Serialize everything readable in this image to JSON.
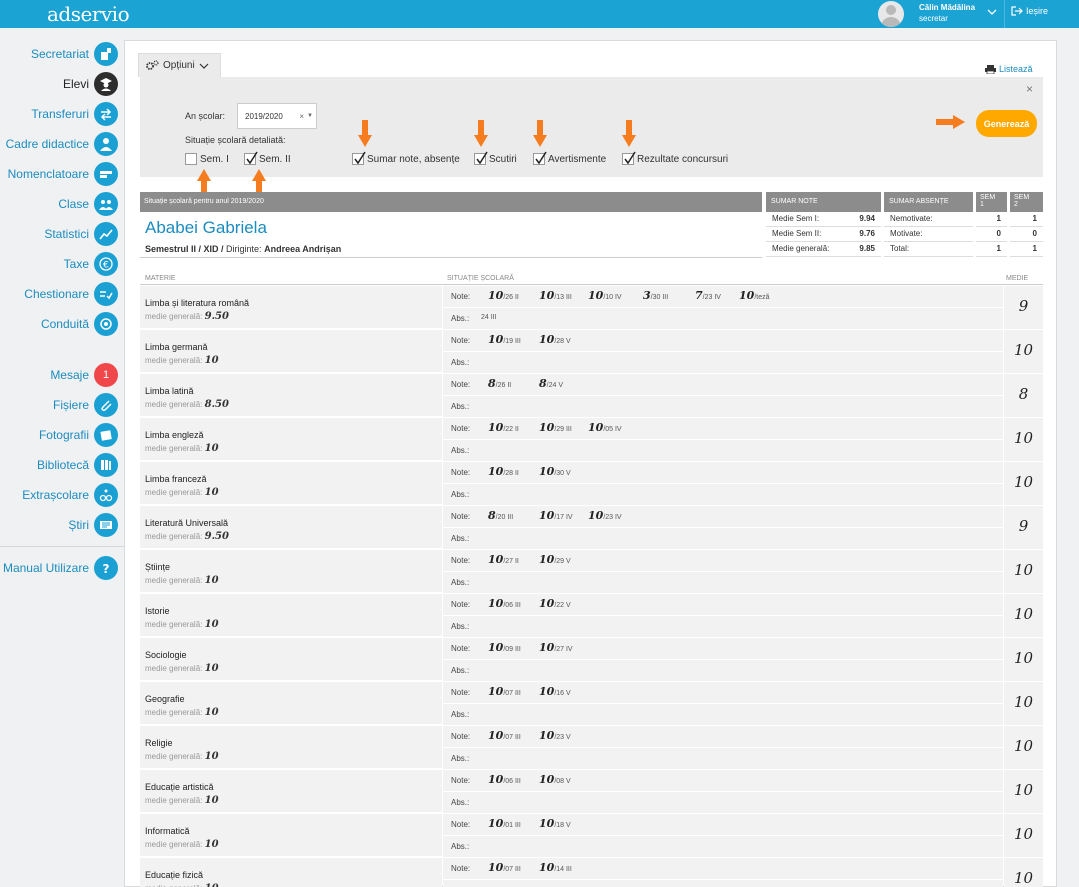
{
  "app": {
    "logo": "adservio"
  },
  "user": {
    "name": "Călin Mădălina",
    "role": "secretar",
    "logout": "Ieșire"
  },
  "sidebar": {
    "items": [
      {
        "label": "Secretariat"
      },
      {
        "label": "Elevi"
      },
      {
        "label": "Transferuri"
      },
      {
        "label": "Cadre didactice"
      },
      {
        "label": "Nomenclatoare"
      },
      {
        "label": "Clase"
      },
      {
        "label": "Statistici"
      },
      {
        "label": "Taxe"
      },
      {
        "label": "Chestionare"
      },
      {
        "label": "Conduită"
      },
      {
        "label": "Mesaje",
        "badge": "1"
      },
      {
        "label": "Fișiere"
      },
      {
        "label": "Fotografii"
      },
      {
        "label": "Bibliotecă"
      },
      {
        "label": "Extrașcolare"
      },
      {
        "label": "Știri"
      },
      {
        "label": "Manual Utilizare"
      }
    ]
  },
  "options": {
    "tab": "Opțiuni",
    "print": "Listează",
    "year_label": "An școlar:",
    "year_value": "2019/2020",
    "situation_label": "Situație școlară detaliată:",
    "checkboxes": [
      {
        "label": "Sem. I",
        "checked": false
      },
      {
        "label": "Sem. II",
        "checked": true
      },
      {
        "label": "Sumar note, absențe",
        "checked": true
      },
      {
        "label": "Scutiri",
        "checked": true
      },
      {
        "label": "Avertismente",
        "checked": true
      },
      {
        "label": "Rezultate concursuri",
        "checked": true
      }
    ],
    "generate": "Generează"
  },
  "report": {
    "header": "Situație școlară pentru anul 2019/2020",
    "student": "Ababei Gabriela",
    "semester": "Semestrul II / XID /",
    "teacher_label": "Diriginte:",
    "teacher": "Andreea Andrișan",
    "sumar_note": {
      "title": "SUMAR NOTE",
      "rows": [
        {
          "k": "Medie Sem I:",
          "v": "9.94"
        },
        {
          "k": "Medie Sem II:",
          "v": "9.76"
        },
        {
          "k": "Medie generală:",
          "v": "9.85"
        }
      ]
    },
    "sumar_absente": {
      "title": "SUMAR ABSENȚE",
      "sem1": "SEM 1",
      "sem2": "SEM 2",
      "rows": [
        {
          "k": "Nemotivate:",
          "s1": "1",
          "s2": "1"
        },
        {
          "k": "Motivate:",
          "s1": "0",
          "s2": "0"
        },
        {
          "k": "Total:",
          "s1": "1",
          "s2": "1"
        }
      ]
    },
    "columns": {
      "subject": "MATERIE",
      "situation": "SITUAȚIE ȘCOLARĂ",
      "average": "MEDIE"
    },
    "notes_label": "Note:",
    "abs_label": "Abs.:",
    "mg_label": "medie generală:",
    "subjects": [
      {
        "name": "Limba și literatura română",
        "mg": "9.50",
        "avg": "9",
        "grades": [
          {
            "g": "10",
            "d": "/26 II"
          },
          {
            "g": "10",
            "d": "/13 III"
          },
          {
            "g": "10",
            "d": "/10 IV"
          },
          {
            "g": "3",
            "d": "/30 III"
          },
          {
            "g": "7",
            "d": "/23 IV"
          },
          {
            "g": "10",
            "d": "/teză"
          }
        ],
        "abs": "24 III"
      },
      {
        "name": "Limba germană",
        "mg": "10",
        "avg": "10",
        "grades": [
          {
            "g": "10",
            "d": "/19 III"
          },
          {
            "g": "10",
            "d": "/28 V"
          }
        ],
        "abs": ""
      },
      {
        "name": "Limba latină",
        "mg": "8.50",
        "avg": "8",
        "grades": [
          {
            "g": "8",
            "d": "/26 II"
          },
          {
            "g": "8",
            "d": "/24 V"
          }
        ],
        "abs": ""
      },
      {
        "name": "Limba engleză",
        "mg": "10",
        "avg": "10",
        "grades": [
          {
            "g": "10",
            "d": "/22 II"
          },
          {
            "g": "10",
            "d": "/29 III"
          },
          {
            "g": "10",
            "d": "/05 IV"
          }
        ],
        "abs": ""
      },
      {
        "name": "Limba franceză",
        "mg": "10",
        "avg": "10",
        "grades": [
          {
            "g": "10",
            "d": "/28 II"
          },
          {
            "g": "10",
            "d": "/30 V"
          }
        ],
        "abs": ""
      },
      {
        "name": "Literatură Universală",
        "mg": "9.50",
        "avg": "9",
        "grades": [
          {
            "g": "8",
            "d": "/20 III"
          },
          {
            "g": "10",
            "d": "/17 IV"
          },
          {
            "g": "10",
            "d": "/23 IV"
          }
        ],
        "abs": ""
      },
      {
        "name": "Științe",
        "mg": "10",
        "avg": "10",
        "grades": [
          {
            "g": "10",
            "d": "/27 II"
          },
          {
            "g": "10",
            "d": "/29 V"
          }
        ],
        "abs": ""
      },
      {
        "name": "Istorie",
        "mg": "10",
        "avg": "10",
        "grades": [
          {
            "g": "10",
            "d": "/06 III"
          },
          {
            "g": "10",
            "d": "/22 V"
          }
        ],
        "abs": ""
      },
      {
        "name": "Sociologie",
        "mg": "10",
        "avg": "10",
        "grades": [
          {
            "g": "10",
            "d": "/09 III"
          },
          {
            "g": "10",
            "d": "/27 IV"
          }
        ],
        "abs": ""
      },
      {
        "name": "Geografie",
        "mg": "10",
        "avg": "10",
        "grades": [
          {
            "g": "10",
            "d": "/07 III"
          },
          {
            "g": "10",
            "d": "/16 V"
          }
        ],
        "abs": ""
      },
      {
        "name": "Religie",
        "mg": "10",
        "avg": "10",
        "grades": [
          {
            "g": "10",
            "d": "/07 III"
          },
          {
            "g": "10",
            "d": "/23 V"
          }
        ],
        "abs": ""
      },
      {
        "name": "Educație artistică",
        "mg": "10",
        "avg": "10",
        "grades": [
          {
            "g": "10",
            "d": "/06 III"
          },
          {
            "g": "10",
            "d": "/08 V"
          }
        ],
        "abs": ""
      },
      {
        "name": "Informatică",
        "mg": "10",
        "avg": "10",
        "grades": [
          {
            "g": "10",
            "d": "/01 III"
          },
          {
            "g": "10",
            "d": "/18 V"
          }
        ],
        "abs": ""
      },
      {
        "name": "Educație fizică",
        "mg": "10",
        "avg": "10",
        "grades": [
          {
            "g": "10",
            "d": "/07 III"
          },
          {
            "g": "10",
            "d": "/14 III"
          }
        ],
        "abs": ""
      }
    ]
  },
  "colors": {
    "brand": "#1ba3d3",
    "accent": "#ffa800",
    "arrow": "#f57c1f",
    "header_gray": "#8c8c8c"
  }
}
